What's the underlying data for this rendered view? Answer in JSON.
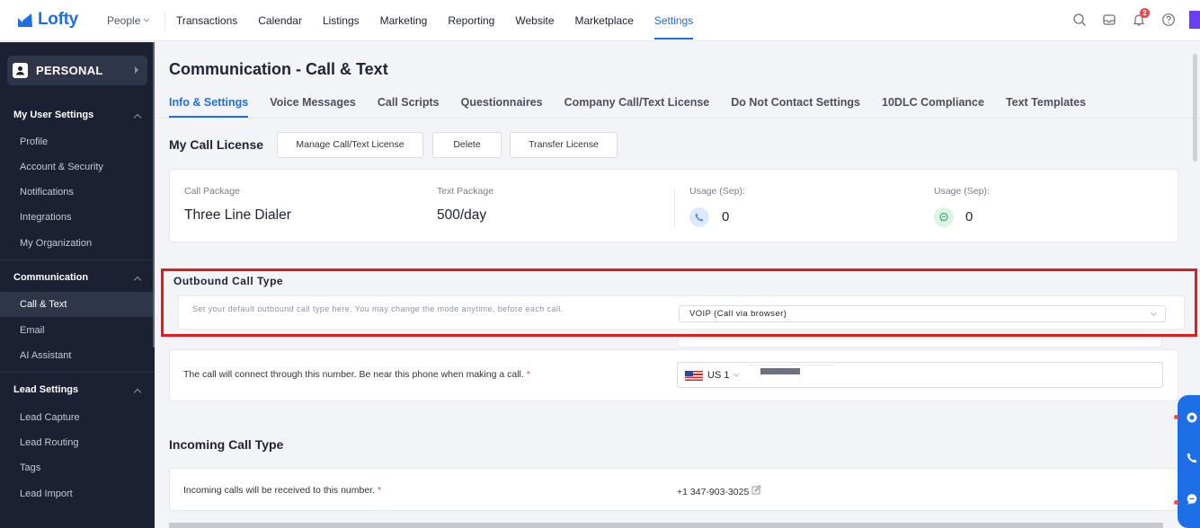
{
  "brand": {
    "name": "Lofty",
    "color": "#1d6fe8"
  },
  "topnav": {
    "people_label": "People",
    "items": [
      {
        "label": "Transactions"
      },
      {
        "label": "Calendar"
      },
      {
        "label": "Listings"
      },
      {
        "label": "Marketing"
      },
      {
        "label": "Reporting"
      },
      {
        "label": "Website"
      },
      {
        "label": "Marketplace"
      },
      {
        "label": "Settings",
        "active": true
      }
    ],
    "icons": [
      "search-icon",
      "inbox-icon",
      "bell-icon",
      "help-icon"
    ],
    "notification_count": "2"
  },
  "sidebar": {
    "personal_label": "PERSONAL",
    "sections": [
      {
        "title": "My User Settings",
        "items": [
          "Profile",
          "Account & Security",
          "Notifications",
          "Integrations",
          "My Organization"
        ]
      },
      {
        "title": "Communication",
        "items": [
          "Call & Text",
          "Email",
          "AI Assistant"
        ],
        "active": "Call & Text"
      },
      {
        "title": "Lead Settings",
        "items": [
          "Lead Capture",
          "Lead Routing",
          "Tags",
          "Lead Import"
        ]
      }
    ]
  },
  "page": {
    "title": "Communication - Call & Text",
    "tabs": [
      {
        "label": "Info & Settings",
        "active": true
      },
      {
        "label": "Voice Messages"
      },
      {
        "label": "Call Scripts"
      },
      {
        "label": "Questionnaires"
      },
      {
        "label": "Company Call/Text License"
      },
      {
        "label": "Do Not Contact Settings"
      },
      {
        "label": "10DLC Compliance"
      },
      {
        "label": "Text Templates"
      }
    ]
  },
  "license": {
    "title": "My Call License",
    "buttons": {
      "manage": "Manage Call/Text License",
      "delete": "Delete",
      "transfer": "Transfer License"
    },
    "call_package_label": "Call Package",
    "call_package_value": "Three Line Dialer",
    "text_package_label": "Text Package",
    "text_package_value": "500/day",
    "usage_call_label": "Usage (Sep):",
    "usage_call_value": "0",
    "usage_text_label": "Usage (Sep):",
    "usage_text_value": "0"
  },
  "outbound": {
    "title": "Outbound Call Type",
    "description": "Set your default outbound call type here. You may change the mode anytime, before each call.",
    "selected": "VOIP (Call via browser)",
    "connect_text": "The call will connect through this number. Be near this phone when making a call.",
    "required_mark": "*",
    "country_code": "US 1"
  },
  "incoming": {
    "title": "Incoming Call Type",
    "text": "Incoming calls will be received to this number.",
    "required_mark": "*",
    "number": "+1 347-903-3025"
  },
  "colors": {
    "accent": "#1d6fe8",
    "highlight": "#e01c1c",
    "sidebar_bg": "#1b2133"
  }
}
